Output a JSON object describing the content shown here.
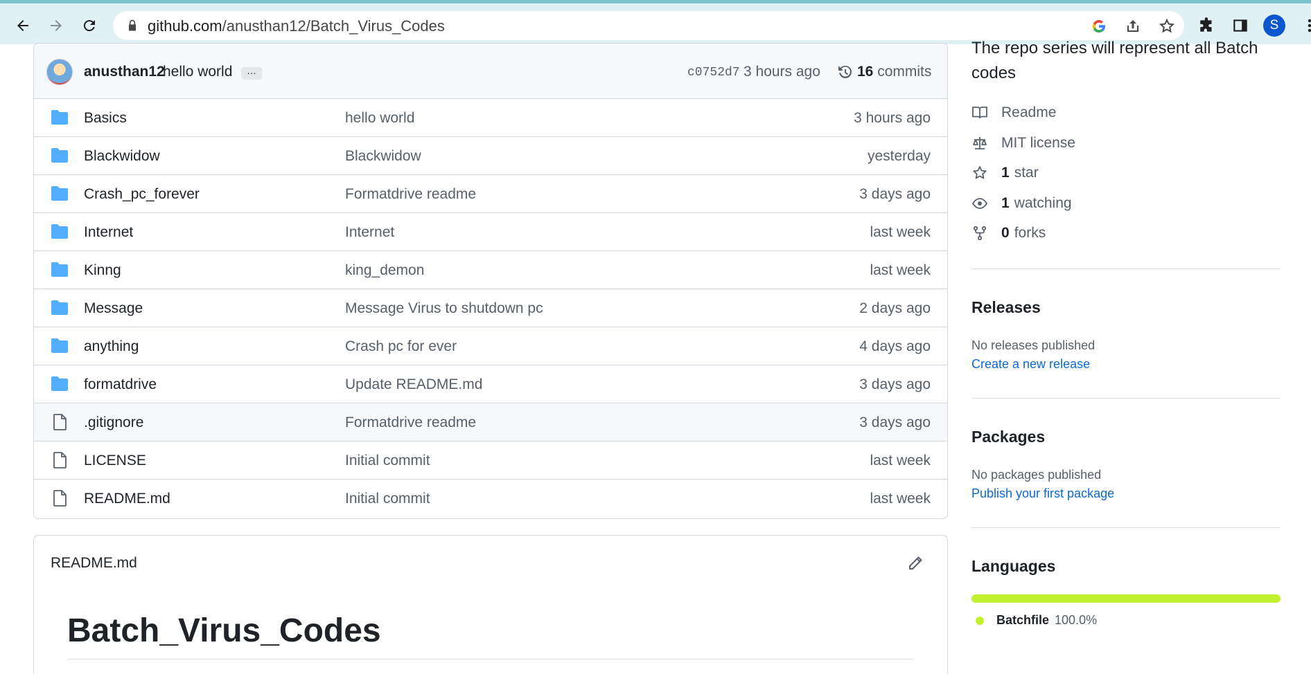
{
  "browser": {
    "url_host": "github.com",
    "url_path": "/anusthan12/Batch_Virus_Codes",
    "profile_initial": "S",
    "accent": "#0b57d0"
  },
  "commit": {
    "author": "anusthan12",
    "message": "hello world",
    "more": "…",
    "sha": "c0752d7",
    "time": "3 hours ago",
    "count": "16",
    "count_label": "commits"
  },
  "files": [
    {
      "type": "folder",
      "name": "Basics",
      "message": "hello world",
      "time": "3 hours ago"
    },
    {
      "type": "folder",
      "name": "Blackwidow",
      "message": "Blackwidow",
      "time": "yesterday"
    },
    {
      "type": "folder",
      "name": "Crash_pc_forever",
      "message": "Formatdrive readme",
      "time": "3 days ago"
    },
    {
      "type": "folder",
      "name": "Internet",
      "message": "Internet",
      "time": "last week"
    },
    {
      "type": "folder",
      "name": "Kinng",
      "message": "king_demon",
      "time": "last week"
    },
    {
      "type": "folder",
      "name": "Message",
      "message": "Message Virus to shutdown pc",
      "time": "2 days ago"
    },
    {
      "type": "folder",
      "name": "anything",
      "message": "Crash pc for ever",
      "time": "4 days ago"
    },
    {
      "type": "folder",
      "name": "formatdrive",
      "message": "Update README.md",
      "time": "3 days ago"
    },
    {
      "type": "file",
      "name": ".gitignore",
      "message": "Formatdrive readme",
      "time": "3 days ago"
    },
    {
      "type": "file",
      "name": "LICENSE",
      "message": "Initial commit",
      "time": "last week"
    },
    {
      "type": "file",
      "name": "README.md",
      "message": "Initial commit",
      "time": "last week"
    }
  ],
  "readme": {
    "filename": "README.md",
    "title": "Batch_Virus_Codes"
  },
  "about": {
    "description": "The repo series will represent all Batch codes",
    "readme_label": "Readme",
    "license_label": "MIT license",
    "stars_count": "1",
    "stars_label": "star",
    "watching_count": "1",
    "watching_label": "watching",
    "forks_count": "0",
    "forks_label": "forks"
  },
  "releases": {
    "heading": "Releases",
    "status": "No releases published",
    "link": "Create a new release"
  },
  "packages": {
    "heading": "Packages",
    "status": "No packages published",
    "link": "Publish your first package"
  },
  "languages": {
    "heading": "Languages",
    "items": [
      {
        "name": "Batchfile",
        "percent": "100.0%",
        "color": "#c1f12e"
      }
    ]
  }
}
